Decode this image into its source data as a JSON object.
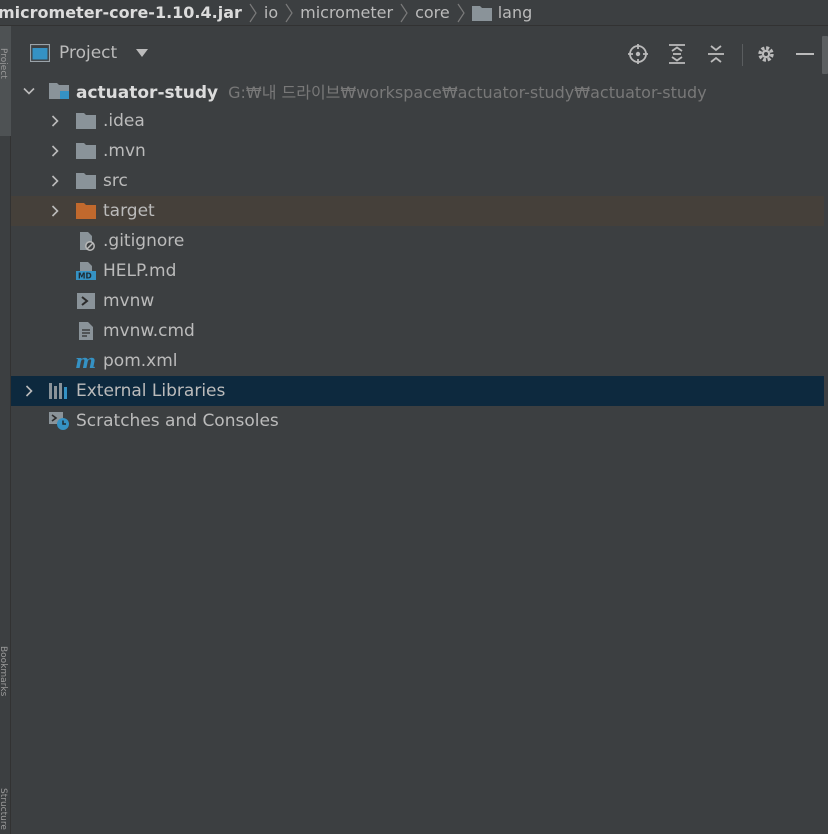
{
  "breadcrumb": {
    "items": [
      "micrometer-core-1.10.4.jar",
      "io",
      "micrometer",
      "core",
      "lang"
    ]
  },
  "stripe": {
    "top_label": "Project",
    "mid_label": "Bookmarks",
    "bottom_label": "Structure"
  },
  "toolwindow": {
    "title": "Project",
    "icons": [
      "locate-icon",
      "expand-all-icon",
      "collapse-all-icon",
      "gear-icon",
      "minimize-icon"
    ]
  },
  "tree": {
    "root": {
      "label": "actuator-study",
      "path": "G:₩내 드라이브₩workspace₩actuator-study₩actuator-study"
    },
    "items": [
      {
        "label": ".idea",
        "icon": "folder-icon"
      },
      {
        "label": ".mvn",
        "icon": "folder-icon"
      },
      {
        "label": "src",
        "icon": "folder-icon"
      },
      {
        "label": "target",
        "icon": "excluded-folder-icon"
      },
      {
        "label": ".gitignore",
        "icon": "ignore-file-icon"
      },
      {
        "label": "HELP.md",
        "icon": "markdown-file-icon"
      },
      {
        "label": "mvnw",
        "icon": "shell-script-icon"
      },
      {
        "label": "mvnw.cmd",
        "icon": "text-file-icon"
      },
      {
        "label": "pom.xml",
        "icon": "maven-icon"
      }
    ],
    "external_libraries": "External Libraries",
    "scratches": "Scratches and Consoles"
  },
  "colors": {
    "background": "#3c3f41",
    "selection": "#0d293e",
    "excluded_row": "#45403a",
    "folder": "#8a9399",
    "excluded_folder": "#c1692d",
    "accent_blue": "#3592c4"
  }
}
